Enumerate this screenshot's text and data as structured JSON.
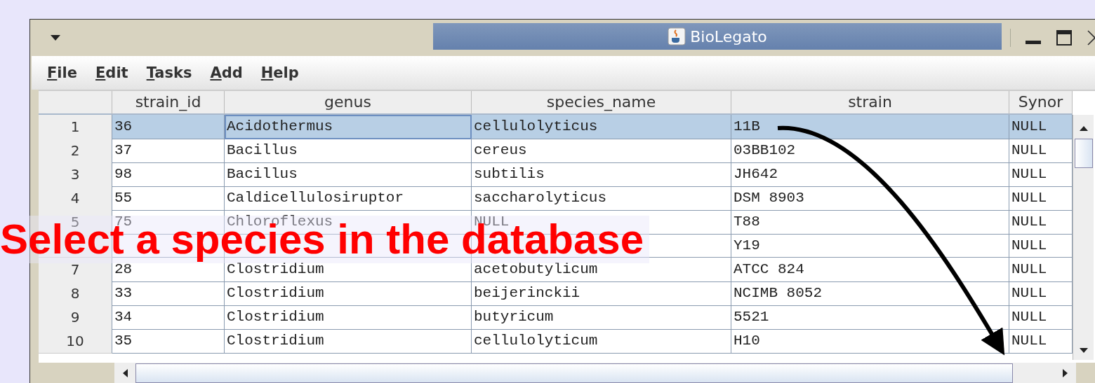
{
  "window": {
    "title": "BioLegato"
  },
  "menu": [
    "File",
    "Edit",
    "Tasks",
    "Add",
    "Help"
  ],
  "table": {
    "columns": [
      "strain_id",
      "genus",
      "species_name",
      "strain",
      "Synor"
    ],
    "rows": [
      {
        "number": "1",
        "selected": true,
        "cells": [
          "36",
          "Acidothermus",
          "cellulolyticus",
          "11B",
          "NULL"
        ]
      },
      {
        "number": "2",
        "selected": false,
        "cells": [
          "37",
          "Bacillus",
          "cereus",
          "03BB102",
          "NULL"
        ]
      },
      {
        "number": "3",
        "selected": false,
        "cells": [
          "98",
          "Bacillus",
          "subtilis",
          "JH642",
          "NULL"
        ]
      },
      {
        "number": "4",
        "selected": false,
        "cells": [
          "55",
          "Caldicellulosiruptor",
          "saccharolyticus",
          "DSM 8903",
          "NULL"
        ]
      },
      {
        "number": "5",
        "selected": false,
        "cells": [
          "75",
          "Chloroflexus",
          "NULL",
          "T88",
          "NULL"
        ]
      },
      {
        "selected": false,
        "cells": [
          null,
          null,
          null,
          "Y19",
          "NULL"
        ]
      },
      {
        "number": "7",
        "selected": false,
        "cells": [
          "28",
          "Clostridium",
          "acetobutylicum",
          "ATCC 824",
          "NULL"
        ]
      },
      {
        "number": "8",
        "selected": false,
        "cells": [
          "33",
          "Clostridium",
          "beijerinckii",
          "NCIMB 8052",
          "NULL"
        ]
      },
      {
        "number": "9",
        "selected": false,
        "cells": [
          "34",
          "Clostridium",
          "butyricum",
          "5521",
          "NULL"
        ]
      },
      {
        "number": "10",
        "selected": false,
        "cells": [
          "35",
          "Clostridium",
          "cellulolyticum",
          "H10",
          "NULL"
        ]
      }
    ]
  },
  "annotation": {
    "text": "Select a species in the database"
  }
}
